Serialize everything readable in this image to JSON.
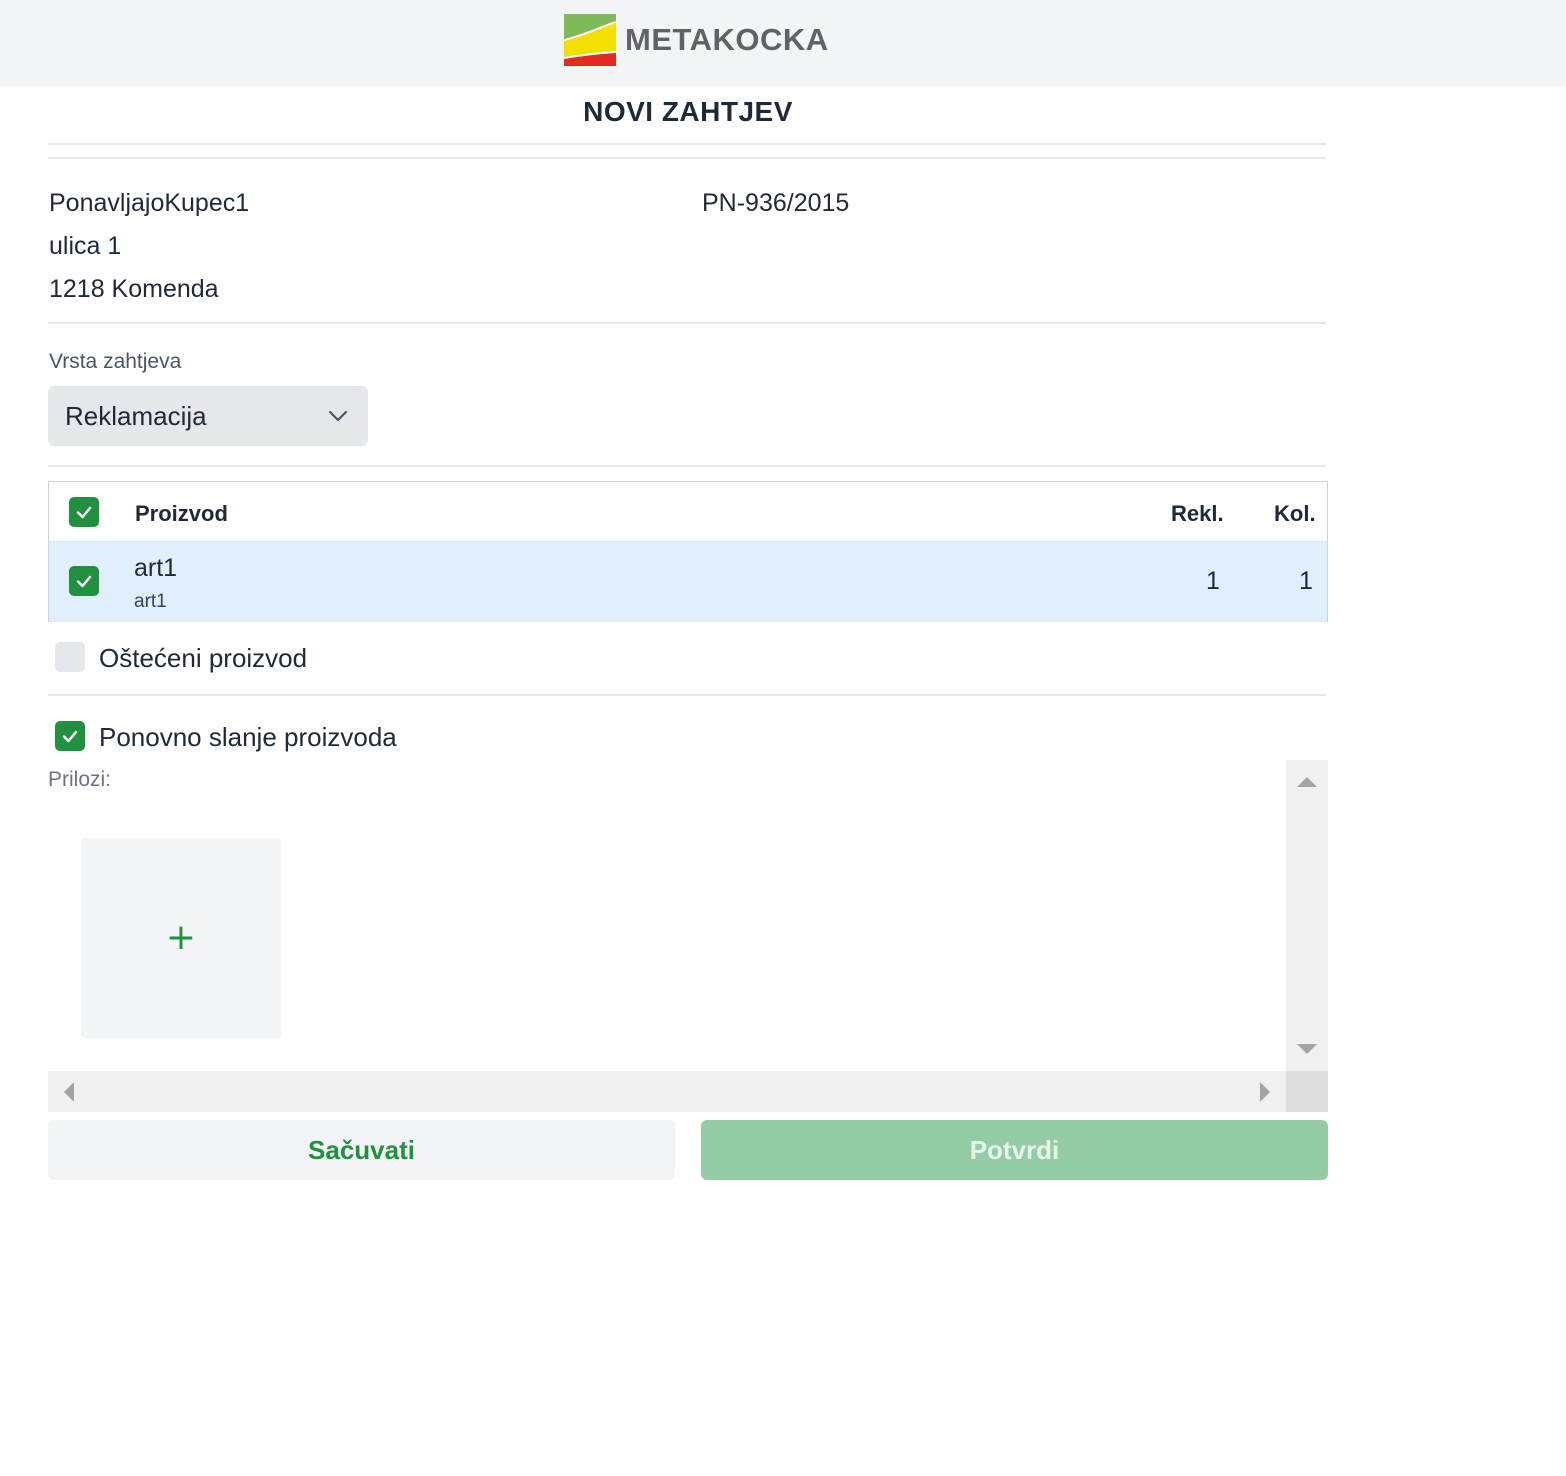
{
  "header": {
    "brand_name": "METAKOCKA",
    "logo_icon": "metakocka-logo-icon"
  },
  "page": {
    "title": "NOVI ZAHTJEV"
  },
  "customer": {
    "name": "PonavljajoKupec1",
    "street": "ulica 1",
    "city": "1218 Komenda",
    "document_number": "PN-936/2015"
  },
  "request_type": {
    "label": "Vrsta zahtjeva",
    "selected": "Reklamacija"
  },
  "products_table": {
    "select_all_checked": true,
    "columns": {
      "product": "Proizvod",
      "reclaimed": "Rekl.",
      "quantity": "Kol."
    },
    "rows": [
      {
        "checked": true,
        "name": "art1",
        "code": "art1",
        "reclaimed": "1",
        "quantity": "1"
      }
    ]
  },
  "options": {
    "damaged_product": {
      "label": "Oštećeni proizvod",
      "checked": false
    },
    "resend_product": {
      "label": "Ponovno slanje proizvoda",
      "checked": true
    }
  },
  "attachments": {
    "label": "Prilozi:",
    "add_symbol": "+"
  },
  "actions": {
    "save_label": "Sačuvati",
    "confirm_label": "Potvrdi",
    "confirm_disabled": true
  },
  "colors": {
    "accent": "#22913f",
    "selected_row": "#e1eefc",
    "confirm_disabled_bg": "#94cda5"
  }
}
